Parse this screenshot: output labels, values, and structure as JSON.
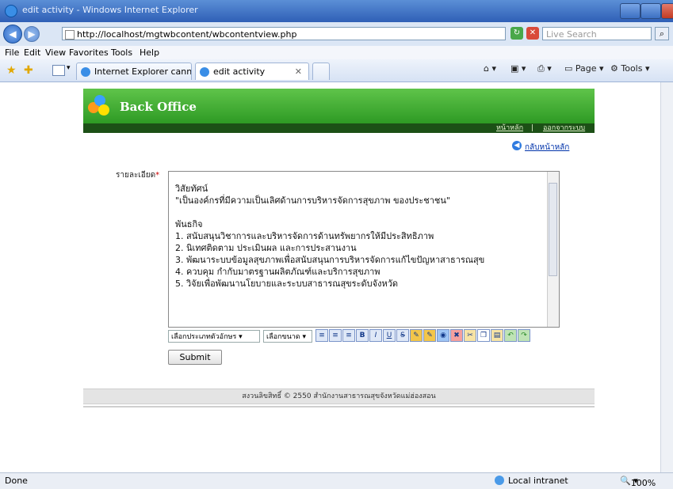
{
  "window": {
    "title": "edit activity - Windows Internet Explorer"
  },
  "address_bar": {
    "url": "http://localhost/mgtwbcontent/wbcontentview.php",
    "search_placeholder": "Live Search"
  },
  "menu": [
    "File",
    "Edit",
    "View",
    "Favorites",
    "Tools",
    "Help"
  ],
  "tabs": [
    {
      "label": "Internet Explorer cannot..."
    },
    {
      "label": "edit activity"
    }
  ],
  "command_bar": {
    "page": "Page",
    "tools": "Tools"
  },
  "page": {
    "header_title": "Back Office",
    "nav": {
      "home": "หน้าหลัก",
      "separator": "|",
      "logout": "ออกจากระบบ"
    },
    "back_link": "กลับหน้าหลัก",
    "field_label": "รายละเอียด",
    "required_mark": "*",
    "editor_text": "วิสัยทัศน์\n\"เป็นองค์กรที่มีความเป็นเลิศด้านการบริหารจัดการสุขภาพ ของประชาชน\"\n\nพันธกิจ\n1. สนับสนุนวิชาการและบริหารจัดการด้านทรัพยากรให้มีประสิทธิภาพ\n2. นิเทศติดตาม ประเมินผล และการประสานงาน\n3. พัฒนาระบบข้อมูลสุขภาพเพื่อสนับสนุนการบริหารจัดการแก้ไขปัญหาสาธารณสุข\n4. ควบคุม กำกับมาตรฐานผลิตภัณฑ์และบริการสุขภาพ\n5. วิจัยเพื่อพัฒนานโยบายและระบบสาธารณสุขระดับจังหวัด",
    "font_select": "เลือกประเภทตัวอักษร",
    "size_select": "เลือกขนาด",
    "submit_label": "Submit",
    "footer": "สงวนลิขสิทธิ์ © 2550 สำนักงานสาธารณสุขจังหวัดแม่ฮ่องสอน"
  },
  "status": {
    "text": "Done",
    "zone": "Local intranet",
    "zoom": "100%"
  }
}
